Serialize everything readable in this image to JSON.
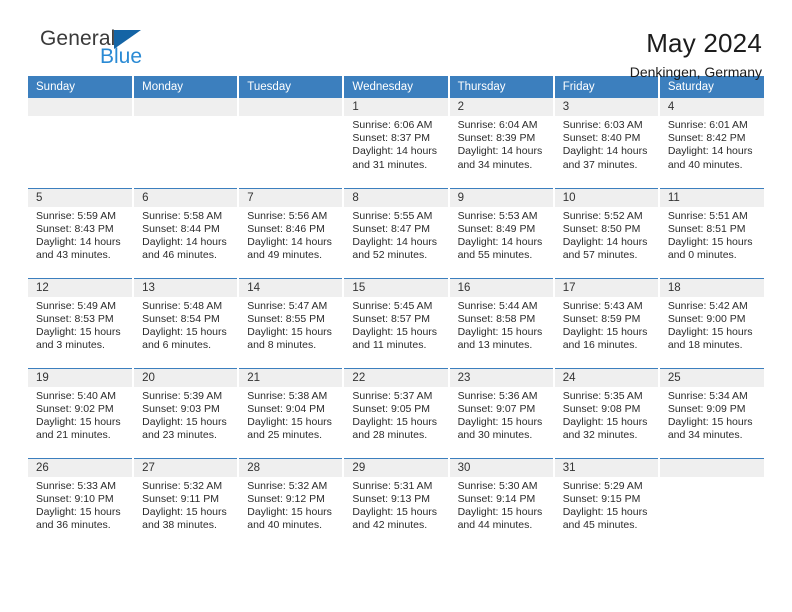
{
  "brand": {
    "name_part1": "General",
    "name_part2": "Blue",
    "triangle_color": "#1464a5",
    "blue_text_color": "#2a8ad4"
  },
  "header": {
    "title": "May 2024",
    "subtitle": "Denkingen, Germany"
  },
  "theme": {
    "header_bg": "#3c7fbe",
    "daynum_bg": "#efefef",
    "rule_color": "#3c7fbe"
  },
  "weekdays": [
    "Sunday",
    "Monday",
    "Tuesday",
    "Wednesday",
    "Thursday",
    "Friday",
    "Saturday"
  ],
  "weeks": [
    [
      {
        "day": "",
        "empty": true
      },
      {
        "day": "",
        "empty": true
      },
      {
        "day": "",
        "empty": true
      },
      {
        "day": "1",
        "sunrise": "Sunrise: 6:06 AM",
        "sunset": "Sunset: 8:37 PM",
        "daylight1": "Daylight: 14 hours",
        "daylight2": "and 31 minutes."
      },
      {
        "day": "2",
        "sunrise": "Sunrise: 6:04 AM",
        "sunset": "Sunset: 8:39 PM",
        "daylight1": "Daylight: 14 hours",
        "daylight2": "and 34 minutes."
      },
      {
        "day": "3",
        "sunrise": "Sunrise: 6:03 AM",
        "sunset": "Sunset: 8:40 PM",
        "daylight1": "Daylight: 14 hours",
        "daylight2": "and 37 minutes."
      },
      {
        "day": "4",
        "sunrise": "Sunrise: 6:01 AM",
        "sunset": "Sunset: 8:42 PM",
        "daylight1": "Daylight: 14 hours",
        "daylight2": "and 40 minutes."
      }
    ],
    [
      {
        "day": "5",
        "sunrise": "Sunrise: 5:59 AM",
        "sunset": "Sunset: 8:43 PM",
        "daylight1": "Daylight: 14 hours",
        "daylight2": "and 43 minutes."
      },
      {
        "day": "6",
        "sunrise": "Sunrise: 5:58 AM",
        "sunset": "Sunset: 8:44 PM",
        "daylight1": "Daylight: 14 hours",
        "daylight2": "and 46 minutes."
      },
      {
        "day": "7",
        "sunrise": "Sunrise: 5:56 AM",
        "sunset": "Sunset: 8:46 PM",
        "daylight1": "Daylight: 14 hours",
        "daylight2": "and 49 minutes."
      },
      {
        "day": "8",
        "sunrise": "Sunrise: 5:55 AM",
        "sunset": "Sunset: 8:47 PM",
        "daylight1": "Daylight: 14 hours",
        "daylight2": "and 52 minutes."
      },
      {
        "day": "9",
        "sunrise": "Sunrise: 5:53 AM",
        "sunset": "Sunset: 8:49 PM",
        "daylight1": "Daylight: 14 hours",
        "daylight2": "and 55 minutes."
      },
      {
        "day": "10",
        "sunrise": "Sunrise: 5:52 AM",
        "sunset": "Sunset: 8:50 PM",
        "daylight1": "Daylight: 14 hours",
        "daylight2": "and 57 minutes."
      },
      {
        "day": "11",
        "sunrise": "Sunrise: 5:51 AM",
        "sunset": "Sunset: 8:51 PM",
        "daylight1": "Daylight: 15 hours",
        "daylight2": "and 0 minutes."
      }
    ],
    [
      {
        "day": "12",
        "sunrise": "Sunrise: 5:49 AM",
        "sunset": "Sunset: 8:53 PM",
        "daylight1": "Daylight: 15 hours",
        "daylight2": "and 3 minutes."
      },
      {
        "day": "13",
        "sunrise": "Sunrise: 5:48 AM",
        "sunset": "Sunset: 8:54 PM",
        "daylight1": "Daylight: 15 hours",
        "daylight2": "and 6 minutes."
      },
      {
        "day": "14",
        "sunrise": "Sunrise: 5:47 AM",
        "sunset": "Sunset: 8:55 PM",
        "daylight1": "Daylight: 15 hours",
        "daylight2": "and 8 minutes."
      },
      {
        "day": "15",
        "sunrise": "Sunrise: 5:45 AM",
        "sunset": "Sunset: 8:57 PM",
        "daylight1": "Daylight: 15 hours",
        "daylight2": "and 11 minutes."
      },
      {
        "day": "16",
        "sunrise": "Sunrise: 5:44 AM",
        "sunset": "Sunset: 8:58 PM",
        "daylight1": "Daylight: 15 hours",
        "daylight2": "and 13 minutes."
      },
      {
        "day": "17",
        "sunrise": "Sunrise: 5:43 AM",
        "sunset": "Sunset: 8:59 PM",
        "daylight1": "Daylight: 15 hours",
        "daylight2": "and 16 minutes."
      },
      {
        "day": "18",
        "sunrise": "Sunrise: 5:42 AM",
        "sunset": "Sunset: 9:00 PM",
        "daylight1": "Daylight: 15 hours",
        "daylight2": "and 18 minutes."
      }
    ],
    [
      {
        "day": "19",
        "sunrise": "Sunrise: 5:40 AM",
        "sunset": "Sunset: 9:02 PM",
        "daylight1": "Daylight: 15 hours",
        "daylight2": "and 21 minutes."
      },
      {
        "day": "20",
        "sunrise": "Sunrise: 5:39 AM",
        "sunset": "Sunset: 9:03 PM",
        "daylight1": "Daylight: 15 hours",
        "daylight2": "and 23 minutes."
      },
      {
        "day": "21",
        "sunrise": "Sunrise: 5:38 AM",
        "sunset": "Sunset: 9:04 PM",
        "daylight1": "Daylight: 15 hours",
        "daylight2": "and 25 minutes."
      },
      {
        "day": "22",
        "sunrise": "Sunrise: 5:37 AM",
        "sunset": "Sunset: 9:05 PM",
        "daylight1": "Daylight: 15 hours",
        "daylight2": "and 28 minutes."
      },
      {
        "day": "23",
        "sunrise": "Sunrise: 5:36 AM",
        "sunset": "Sunset: 9:07 PM",
        "daylight1": "Daylight: 15 hours",
        "daylight2": "and 30 minutes."
      },
      {
        "day": "24",
        "sunrise": "Sunrise: 5:35 AM",
        "sunset": "Sunset: 9:08 PM",
        "daylight1": "Daylight: 15 hours",
        "daylight2": "and 32 minutes."
      },
      {
        "day": "25",
        "sunrise": "Sunrise: 5:34 AM",
        "sunset": "Sunset: 9:09 PM",
        "daylight1": "Daylight: 15 hours",
        "daylight2": "and 34 minutes."
      }
    ],
    [
      {
        "day": "26",
        "sunrise": "Sunrise: 5:33 AM",
        "sunset": "Sunset: 9:10 PM",
        "daylight1": "Daylight: 15 hours",
        "daylight2": "and 36 minutes."
      },
      {
        "day": "27",
        "sunrise": "Sunrise: 5:32 AM",
        "sunset": "Sunset: 9:11 PM",
        "daylight1": "Daylight: 15 hours",
        "daylight2": "and 38 minutes."
      },
      {
        "day": "28",
        "sunrise": "Sunrise: 5:32 AM",
        "sunset": "Sunset: 9:12 PM",
        "daylight1": "Daylight: 15 hours",
        "daylight2": "and 40 minutes."
      },
      {
        "day": "29",
        "sunrise": "Sunrise: 5:31 AM",
        "sunset": "Sunset: 9:13 PM",
        "daylight1": "Daylight: 15 hours",
        "daylight2": "and 42 minutes."
      },
      {
        "day": "30",
        "sunrise": "Sunrise: 5:30 AM",
        "sunset": "Sunset: 9:14 PM",
        "daylight1": "Daylight: 15 hours",
        "daylight2": "and 44 minutes."
      },
      {
        "day": "31",
        "sunrise": "Sunrise: 5:29 AM",
        "sunset": "Sunset: 9:15 PM",
        "daylight1": "Daylight: 15 hours",
        "daylight2": "and 45 minutes."
      },
      {
        "day": "",
        "empty": true
      }
    ]
  ]
}
